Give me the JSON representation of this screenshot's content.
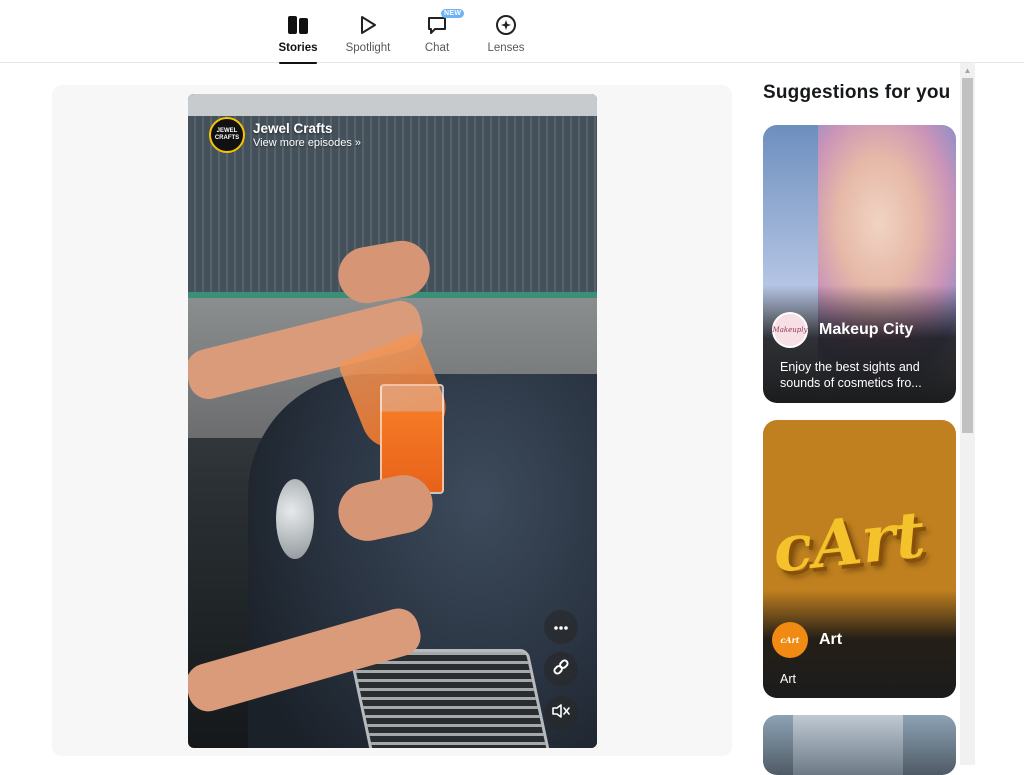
{
  "nav": {
    "items": [
      {
        "label": "Stories",
        "icon": "stories-icon",
        "active": true
      },
      {
        "label": "Spotlight",
        "icon": "spotlight-play-icon",
        "active": false
      },
      {
        "label": "Chat",
        "icon": "chat-icon",
        "active": false,
        "badge": "NEW"
      },
      {
        "label": "Lenses",
        "icon": "lenses-icon",
        "active": false
      }
    ]
  },
  "player": {
    "channel_name": "Jewel Crafts",
    "channel_avatar_text": "JEWEL CRAFTS",
    "view_more": "View more episodes »",
    "controls": [
      "more-options-icon",
      "link-icon",
      "mute-icon"
    ]
  },
  "suggestions": {
    "title": "Suggestions for you",
    "cards": [
      {
        "name": "Makeup City",
        "avatar_text": "Makeuply",
        "description": "Enjoy the best sights and sounds of cosmetics fro..."
      },
      {
        "name": "Art",
        "avatar_text": "cArt",
        "description": "Art",
        "artwork_text": "cArt"
      }
    ]
  },
  "colors": {
    "accent": "#111111",
    "badge": "#6fb3f5",
    "art_card_bg": "#c0801f",
    "card_overlay": "#1b1c1e"
  }
}
